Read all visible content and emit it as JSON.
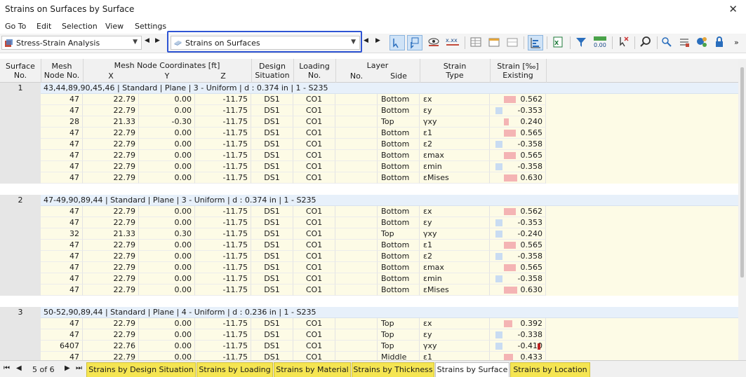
{
  "window": {
    "title": "Strains on Surfaces by Surface",
    "close_glyph": "✕"
  },
  "menu": [
    "Go To",
    "Edit",
    "Selection",
    "View",
    "Settings"
  ],
  "toolbar": {
    "analysis_combo": "Stress-Strain Analysis",
    "result_combo": "Strains on Surfaces"
  },
  "columns": {
    "surface_no": "Surface\nNo.",
    "mesh_node": "Mesh\nNode No.",
    "coords_group": "Mesh Node Coordinates [ft]",
    "x": "X",
    "y": "Y",
    "z": "Z",
    "design_situation": "Design\nSituation",
    "loading_no": "Loading\nNo.",
    "layer_group": "Layer",
    "layer_no": "No.",
    "layer_side": "Side",
    "strain_type": "Strain\nType",
    "strain_existing": "Strain [‰]\nExisting"
  },
  "groups": [
    {
      "surface": "1",
      "title": "43,44,89,90,45,46 | Standard | Plane | 3 - Uniform | d : 0.374 in | 1 - S235",
      "rows": [
        {
          "node": "47",
          "x": "22.79",
          "y": "0.00",
          "z": "-11.75",
          "ds": "DS1",
          "lo": "CO1",
          "ln": "",
          "side": "Bottom",
          "type": "εx",
          "val": "0.562",
          "v": 0.562
        },
        {
          "node": "47",
          "x": "22.79",
          "y": "0.00",
          "z": "-11.75",
          "ds": "DS1",
          "lo": "CO1",
          "ln": "",
          "side": "Bottom",
          "type": "εy",
          "val": "-0.353",
          "v": -0.353
        },
        {
          "node": "28",
          "x": "21.33",
          "y": "-0.30",
          "z": "-11.75",
          "ds": "DS1",
          "lo": "CO1",
          "ln": "",
          "side": "Top",
          "type": "γxy",
          "val": "0.240",
          "v": 0.24
        },
        {
          "node": "47",
          "x": "22.79",
          "y": "0.00",
          "z": "-11.75",
          "ds": "DS1",
          "lo": "CO1",
          "ln": "",
          "side": "Bottom",
          "type": "ε1",
          "val": "0.565",
          "v": 0.565
        },
        {
          "node": "47",
          "x": "22.79",
          "y": "0.00",
          "z": "-11.75",
          "ds": "DS1",
          "lo": "CO1",
          "ln": "",
          "side": "Bottom",
          "type": "ε2",
          "val": "-0.358",
          "v": -0.358
        },
        {
          "node": "47",
          "x": "22.79",
          "y": "0.00",
          "z": "-11.75",
          "ds": "DS1",
          "lo": "CO1",
          "ln": "",
          "side": "Bottom",
          "type": "εmax",
          "val": "0.565",
          "v": 0.565
        },
        {
          "node": "47",
          "x": "22.79",
          "y": "0.00",
          "z": "-11.75",
          "ds": "DS1",
          "lo": "CO1",
          "ln": "",
          "side": "Bottom",
          "type": "εmin",
          "val": "-0.358",
          "v": -0.358
        },
        {
          "node": "47",
          "x": "22.79",
          "y": "0.00",
          "z": "-11.75",
          "ds": "DS1",
          "lo": "CO1",
          "ln": "",
          "side": "Bottom",
          "type": "εMises",
          "val": "0.630",
          "v": 0.63
        }
      ]
    },
    {
      "surface": "2",
      "title": "47-49,90,89,44 | Standard | Plane | 3 - Uniform | d : 0.374 in | 1 - S235",
      "rows": [
        {
          "node": "47",
          "x": "22.79",
          "y": "0.00",
          "z": "-11.75",
          "ds": "DS1",
          "lo": "CO1",
          "ln": "",
          "side": "Bottom",
          "type": "εx",
          "val": "0.562",
          "v": 0.562
        },
        {
          "node": "47",
          "x": "22.79",
          "y": "0.00",
          "z": "-11.75",
          "ds": "DS1",
          "lo": "CO1",
          "ln": "",
          "side": "Bottom",
          "type": "εy",
          "val": "-0.353",
          "v": -0.353
        },
        {
          "node": "32",
          "x": "21.33",
          "y": "0.30",
          "z": "-11.75",
          "ds": "DS1",
          "lo": "CO1",
          "ln": "",
          "side": "Top",
          "type": "γxy",
          "val": "-0.240",
          "v": -0.24
        },
        {
          "node": "47",
          "x": "22.79",
          "y": "0.00",
          "z": "-11.75",
          "ds": "DS1",
          "lo": "CO1",
          "ln": "",
          "side": "Bottom",
          "type": "ε1",
          "val": "0.565",
          "v": 0.565
        },
        {
          "node": "47",
          "x": "22.79",
          "y": "0.00",
          "z": "-11.75",
          "ds": "DS1",
          "lo": "CO1",
          "ln": "",
          "side": "Bottom",
          "type": "ε2",
          "val": "-0.358",
          "v": -0.358
        },
        {
          "node": "47",
          "x": "22.79",
          "y": "0.00",
          "z": "-11.75",
          "ds": "DS1",
          "lo": "CO1",
          "ln": "",
          "side": "Bottom",
          "type": "εmax",
          "val": "0.565",
          "v": 0.565
        },
        {
          "node": "47",
          "x": "22.79",
          "y": "0.00",
          "z": "-11.75",
          "ds": "DS1",
          "lo": "CO1",
          "ln": "",
          "side": "Bottom",
          "type": "εmin",
          "val": "-0.358",
          "v": -0.358
        },
        {
          "node": "47",
          "x": "22.79",
          "y": "0.00",
          "z": "-11.75",
          "ds": "DS1",
          "lo": "CO1",
          "ln": "",
          "side": "Bottom",
          "type": "εMises",
          "val": "0.630",
          "v": 0.63
        }
      ]
    },
    {
      "surface": "3",
      "title": "50-52,90,89,44 | Standard | Plane | 4 - Uniform | d : 0.236 in | 1 - S235",
      "rows": [
        {
          "node": "47",
          "x": "22.79",
          "y": "0.00",
          "z": "-11.75",
          "ds": "DS1",
          "lo": "CO1",
          "ln": "",
          "side": "Top",
          "type": "εx",
          "val": "0.392",
          "v": 0.392
        },
        {
          "node": "47",
          "x": "22.79",
          "y": "0.00",
          "z": "-11.75",
          "ds": "DS1",
          "lo": "CO1",
          "ln": "",
          "side": "Top",
          "type": "εy",
          "val": "-0.338",
          "v": -0.338
        },
        {
          "node": "6407",
          "x": "22.76",
          "y": "0.00",
          "z": "-11.75",
          "ds": "DS1",
          "lo": "CO1",
          "ln": "",
          "side": "Top",
          "type": "γxy",
          "val": "-0.410",
          "v": -0.41,
          "flag": true
        },
        {
          "node": "47",
          "x": "22.79",
          "y": "0.00",
          "z": "-11.75",
          "ds": "DS1",
          "lo": "CO1",
          "ln": "",
          "side": "Middle",
          "type": "ε1",
          "val": "0.433",
          "v": 0.433
        }
      ]
    }
  ],
  "pager": {
    "text": "5 of 6"
  },
  "tabs": [
    "Strains by Design Situation",
    "Strains by Loading",
    "Strains by Material",
    "Strains by Thickness",
    "Strains by Surface",
    "Strains by Location"
  ],
  "active_tab": "Strains by Surface",
  "colors": {
    "positive_bar": "#f4b4b4",
    "negative_bar": "#c9dcf2",
    "tab_yellow": "#f5e552",
    "highlight_border": "#2f55d4",
    "group_row": "#e7f0fa",
    "data_row": "#fdfbe6"
  }
}
